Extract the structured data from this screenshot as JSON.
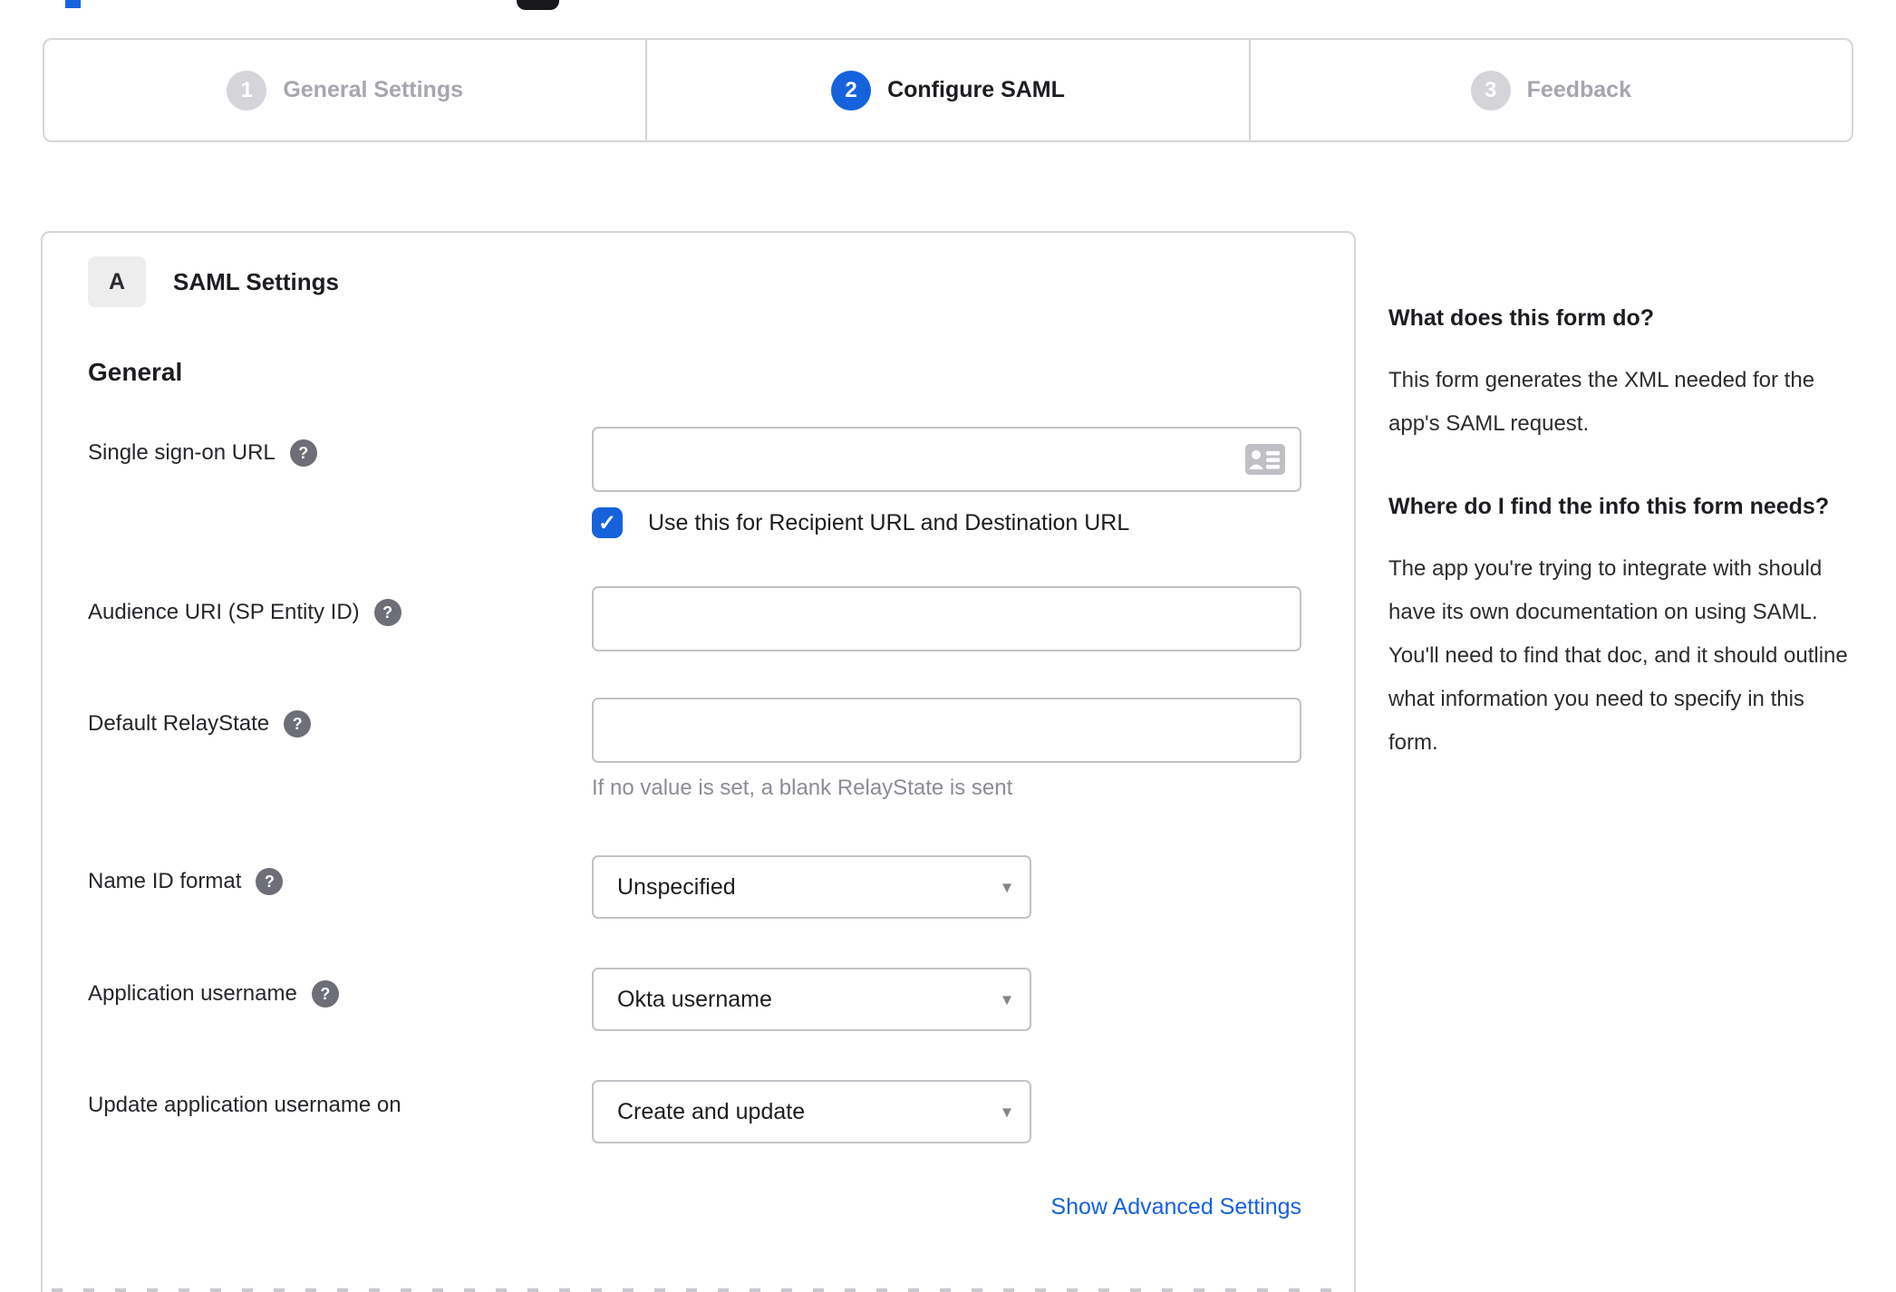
{
  "stepper": {
    "steps": [
      {
        "number": "1",
        "label": "General Settings",
        "state": "inactive"
      },
      {
        "number": "2",
        "label": "Configure SAML",
        "state": "active"
      },
      {
        "number": "3",
        "label": "Feedback",
        "state": "inactive"
      }
    ]
  },
  "panel": {
    "section_badge": "A",
    "section_title": "SAML Settings",
    "group_title": "General",
    "fields": {
      "sso": {
        "label": "Single sign-on URL",
        "value": "",
        "checkbox_label": "Use this for Recipient URL and Destination URL",
        "checked": true
      },
      "audience": {
        "label": "Audience URI (SP Entity ID)",
        "value": ""
      },
      "relaystate": {
        "label": "Default RelayState",
        "value": "",
        "hint": "If no value is set, a blank RelayState is sent"
      },
      "nameid": {
        "label": "Name ID format",
        "value": "Unspecified"
      },
      "appusername": {
        "label": "Application username",
        "value": "Okta username"
      },
      "updateusername": {
        "label": "Update application username on",
        "value": "Create and update"
      }
    },
    "advanced_link": "Show Advanced Settings"
  },
  "sidebar": {
    "block1": {
      "heading": "What does this form do?",
      "body": "This form generates the XML needed for the app's SAML request."
    },
    "block2": {
      "heading": "Where do I find the info this form needs?",
      "body": "The app you're trying to integrate with should have its own documentation on using SAML. You'll need to find that doc, and it should outline what information you need to specify in this form."
    }
  },
  "icons": {
    "help": "?",
    "dropdown_arrow": "▾",
    "checkmark": "✓"
  },
  "colors": {
    "accent_blue": "#1662dd",
    "link_blue": "#1662dd",
    "inactive_gray": "#d4d4d9",
    "border_gray": "#d6d6db"
  }
}
